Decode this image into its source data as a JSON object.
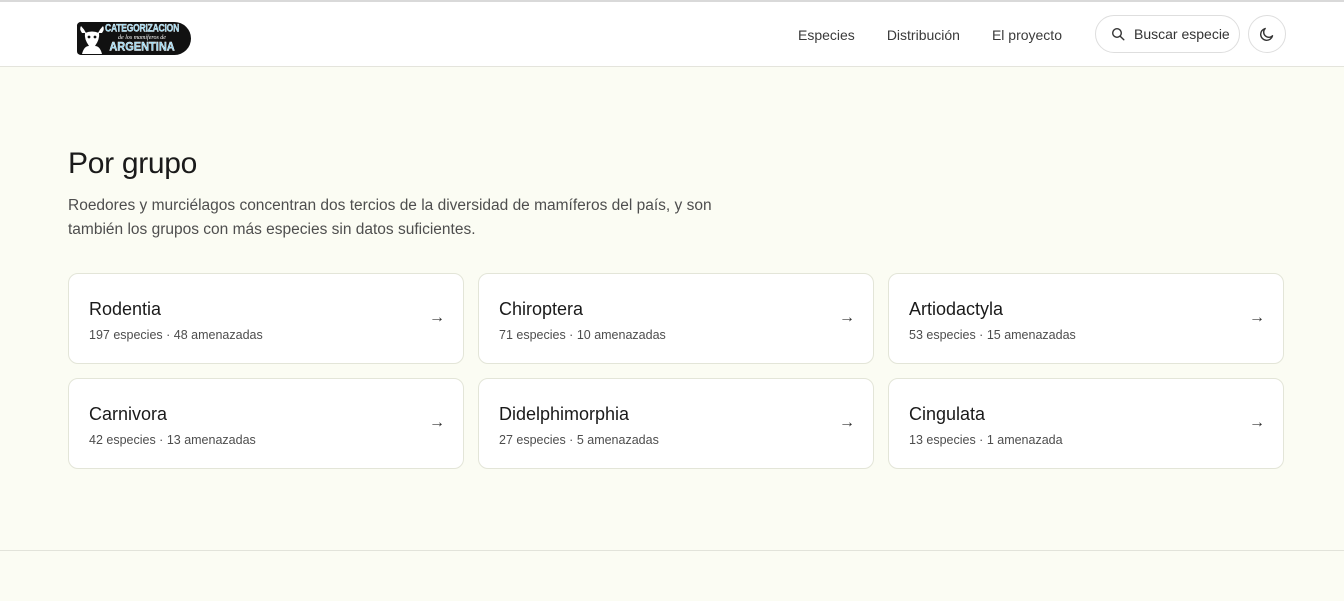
{
  "header": {
    "logo": {
      "line1": "CATEGORIZACION",
      "line2": "de los mamíferos de",
      "line3": "ARGENTINA"
    },
    "nav": [
      {
        "label": "Especies"
      },
      {
        "label": "Distribución"
      },
      {
        "label": "El proyecto"
      }
    ],
    "search": {
      "label": "Buscar especie",
      "icon": "search-icon"
    },
    "theme_toggle": {
      "icon": "moon-icon"
    }
  },
  "main": {
    "title": "Por grupo",
    "description": "Roedores y murciélagos concentran dos tercios de la diversidad de mamíferos del país, y son también los grupos con más especies sin datos suficientes.",
    "groups": [
      {
        "name": "Rodentia",
        "summary": "197 especies · 48 amenazadas",
        "arrow": "→"
      },
      {
        "name": "Chiroptera",
        "summary": "71 especies · 10 amenazadas",
        "arrow": "→"
      },
      {
        "name": "Artiodactyla",
        "summary": "53 especies · 15 amenazadas",
        "arrow": "→"
      },
      {
        "name": "Carnivora",
        "summary": "42 especies · 13 amenazadas",
        "arrow": "→"
      },
      {
        "name": "Didelphimorphia",
        "summary": "27 especies · 5 amenazadas",
        "arrow": "→"
      },
      {
        "name": "Cingulata",
        "summary": "13 especies · 1 amenazada",
        "arrow": "→"
      }
    ]
  },
  "colors": {
    "page_background": "#fbfcf3",
    "header_background": "#ffffff",
    "logo_background": "#111111",
    "logo_text": "#8fd3ef"
  }
}
